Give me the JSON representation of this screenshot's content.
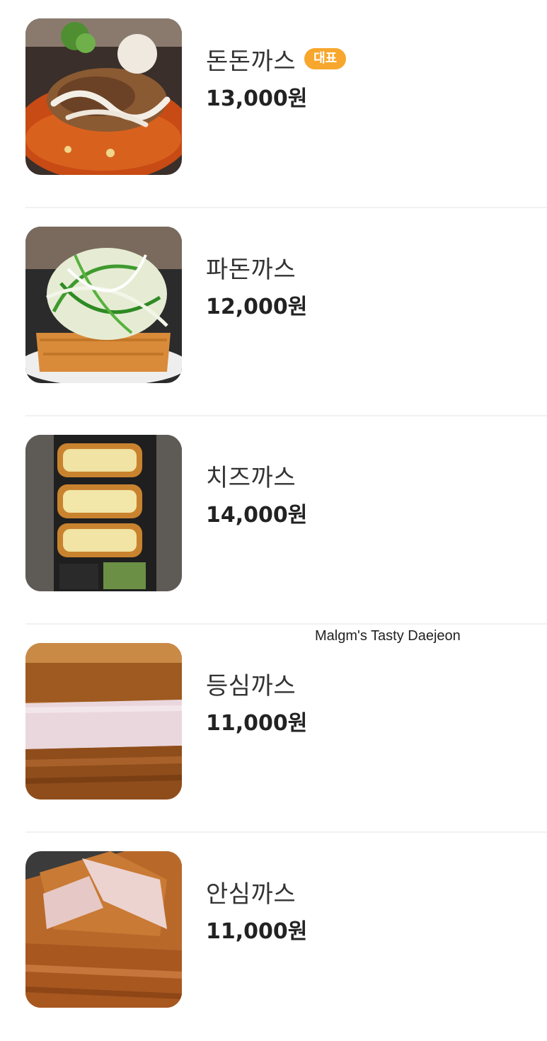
{
  "menu": {
    "items": [
      {
        "name": "돈돈까스",
        "price": "13,000원",
        "badge": "대표",
        "image": "donkatsu-with-sauce-photo"
      },
      {
        "name": "파돈까스",
        "price": "12,000원",
        "badge": null,
        "image": "green-onion-katsu-photo"
      },
      {
        "name": "치즈까스",
        "price": "14,000원",
        "badge": null,
        "image": "cheese-katsu-photo"
      },
      {
        "name": "등심까스",
        "price": "11,000원",
        "badge": null,
        "image": "pork-loin-katsu-photo"
      },
      {
        "name": "안심까스",
        "price": "11,000원",
        "badge": null,
        "image": "tenderloin-katsu-photo"
      }
    ]
  },
  "watermark": "Malgm's Tasty Daejeon",
  "colors": {
    "badge": "#f7a72d",
    "divider": "#f1f1f1",
    "price_text": "#222222",
    "name_text": "#333333"
  }
}
